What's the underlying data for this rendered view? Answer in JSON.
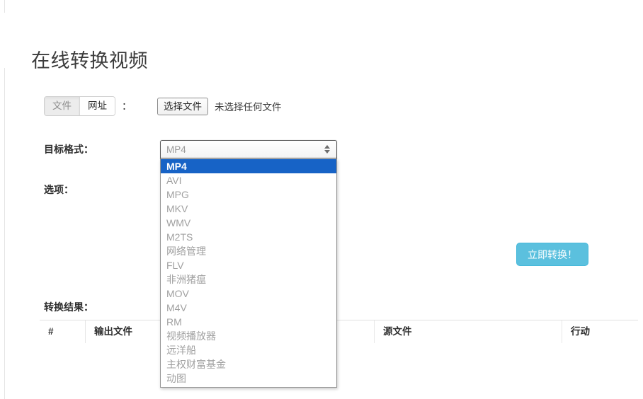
{
  "page": {
    "title": "在线转换视频"
  },
  "source_row": {
    "tabs": [
      {
        "label": "文件",
        "active": true
      },
      {
        "label": "网址",
        "active": false
      }
    ],
    "separator": "：",
    "file_button_label": "选择文件",
    "file_status": "未选择任何文件"
  },
  "format": {
    "label": "目标格式：",
    "selected": "MP4",
    "options": [
      "MP4",
      "AVI",
      "MPG",
      "MKV",
      "WMV",
      "M2TS",
      "网络管理",
      "FLV",
      "非洲猪瘟",
      "MOV",
      "M4V",
      "RM",
      "视频播放器",
      "远洋船",
      "主权财富基金",
      "动图"
    ]
  },
  "options": {
    "label": "选项："
  },
  "actions": {
    "convert_label": "立即转换！"
  },
  "results": {
    "label": "转换结果：",
    "columns": [
      "#",
      "输出文件",
      "",
      "源文件",
      "行动"
    ]
  },
  "colors": {
    "accent": "#5bc0de",
    "highlight": "#1763c6",
    "text": "#333333",
    "muted": "#a0a0a0",
    "border": "#e0e0e0"
  }
}
